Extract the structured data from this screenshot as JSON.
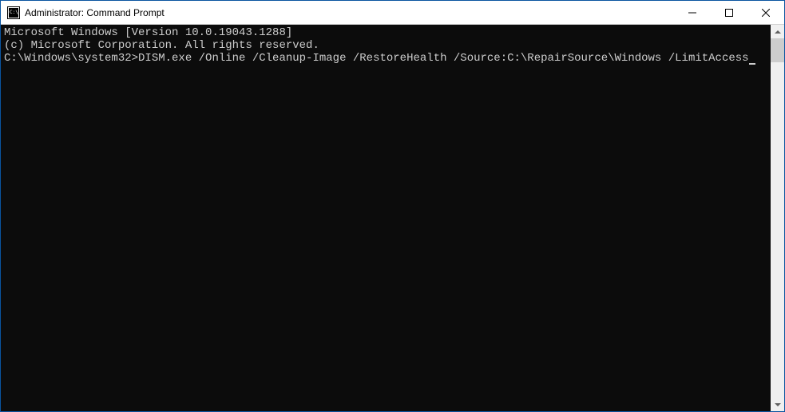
{
  "window": {
    "title": "Administrator: Command Prompt"
  },
  "terminal": {
    "lines": [
      "Microsoft Windows [Version 10.0.19043.1288]",
      "(c) Microsoft Corporation. All rights reserved.",
      "",
      "C:\\Windows\\system32>DISM.exe /Online /Cleanup-Image /RestoreHealth /Source:C:\\RepairSource\\Windows /LimitAccess"
    ],
    "prompt": "C:\\Windows\\system32>",
    "command": "DISM.exe /Online /Cleanup-Image /RestoreHealth /Source:C:\\RepairSource\\Windows /LimitAccess",
    "version_line": "Microsoft Windows [Version 10.0.19043.1288]",
    "copyright_line": "(c) Microsoft Corporation. All rights reserved."
  }
}
